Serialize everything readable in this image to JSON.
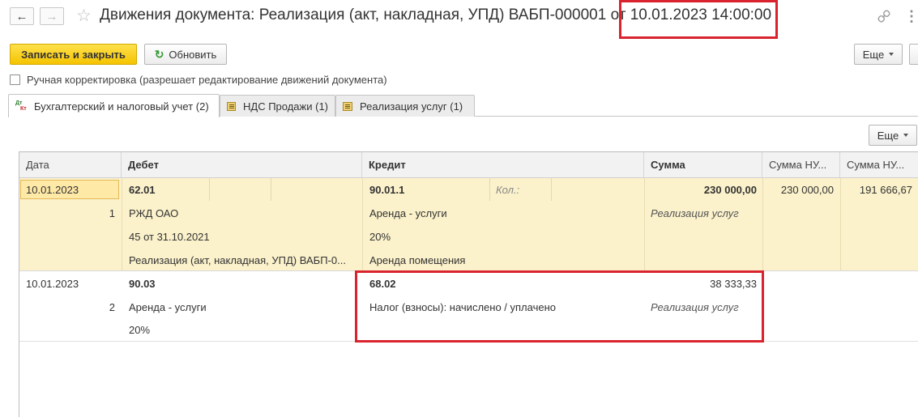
{
  "title": {
    "main": "Движения документа: Реализация (акт, накладная, УПД) ВАБП-000001 от",
    "datetime": "10.01.2023 14:00:00"
  },
  "icons": {
    "back": "←",
    "forward": "→",
    "star": "☆",
    "link": "🔗",
    "more": "⋮",
    "refresh": "↻"
  },
  "toolbar": {
    "save_close": "Записать и закрыть",
    "refresh": "Обновить",
    "more": "Еще"
  },
  "manual_edit": {
    "label": "Ручная корректировка (разрешает редактирование движений документа)"
  },
  "tabs": [
    {
      "label": "Бухгалтерский и налоговый учет (2)"
    },
    {
      "label": "НДС Продажи (1)"
    },
    {
      "label": "Реализация услуг (1)"
    }
  ],
  "grid": {
    "more": "Еще",
    "columns": [
      "Дата",
      "Дебет",
      "Кредит",
      "Сумма",
      "Сумма НУ...",
      "Сумма НУ..."
    ],
    "rows": [
      {
        "date": "10.01.2023",
        "num": "1",
        "debit_account": "62.01",
        "debit_lines": [
          "РЖД ОАО",
          "45 от 31.10.2021",
          "Реализация (акт, накладная, УПД) ВАБП-0..."
        ],
        "credit_account": "90.01.1",
        "credit_qty": "Кол.:",
        "credit_lines": [
          "Аренда - услуги",
          "20%",
          "Аренда помещения"
        ],
        "amount": "230 000,00",
        "content": "Реализация услуг",
        "amount_nu_dt": "230 000,00",
        "amount_nu_kt": "191 666,67"
      },
      {
        "date": "10.01.2023",
        "num": "2",
        "debit_account": "90.03",
        "debit_lines": [
          "Аренда - услуги",
          "20%"
        ],
        "credit_account": "68.02",
        "credit_lines": [
          "Налог (взносы): начислено / уплачено"
        ],
        "amount": "38 333,33",
        "content": "Реализация услуг"
      }
    ]
  },
  "colors": {
    "accent_yellow": "#f5c400",
    "selected_row": "#fbf1cb",
    "annotation_red": "#d9232e"
  }
}
